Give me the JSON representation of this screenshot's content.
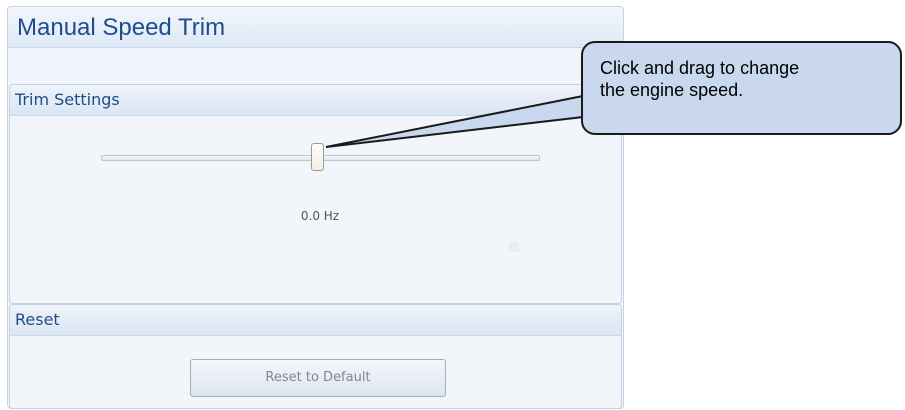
{
  "panel": {
    "title": "Manual Speed Trim"
  },
  "trim_settings": {
    "header": "Trim Settings",
    "slider_value_text": "0.0 Hz"
  },
  "reset": {
    "header": "Reset",
    "button_label": "Reset to Default"
  },
  "callout": {
    "line1": "Click and drag to change",
    "line2": "the engine speed."
  },
  "colors": {
    "title_text": "#1f4d8a",
    "panel_bg": "#f0f5fb",
    "callout_bg": "#c9d8ee"
  }
}
